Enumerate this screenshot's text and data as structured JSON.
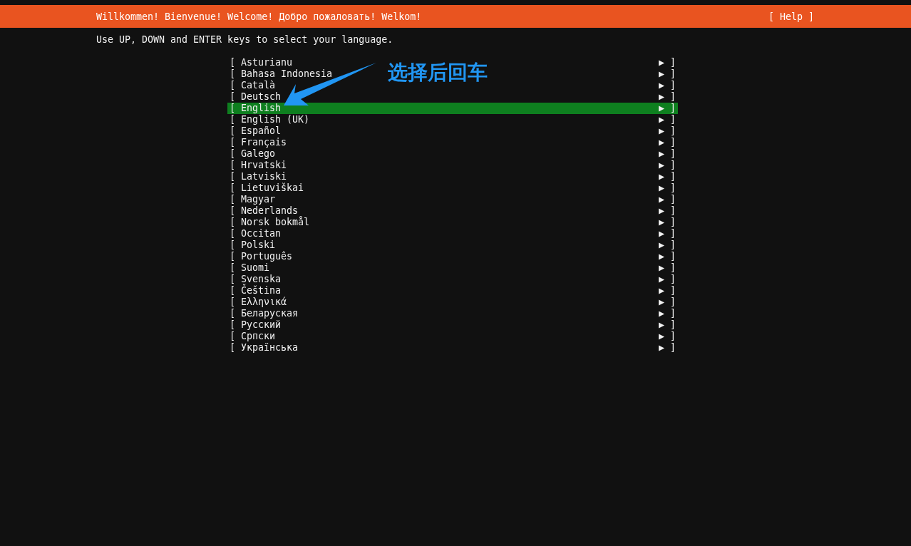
{
  "header": {
    "title": "Willkommen! Bienvenue! Welcome! Добро пожаловать! Welkom!",
    "help": "[ Help ]"
  },
  "instruction": "Use UP, DOWN and ENTER keys to select your language.",
  "languages": [
    {
      "text": "[ Asturianu",
      "end": "▶ ]",
      "selected": false
    },
    {
      "text": "[ Bahasa Indonesia",
      "end": "▶ ]",
      "selected": false
    },
    {
      "text": "[ Català",
      "end": "▶ ]",
      "selected": false
    },
    {
      "text": "[ Deutsch",
      "end": "▶ ]",
      "selected": false
    },
    {
      "text": "[ English",
      "end": "▶ ]",
      "selected": true
    },
    {
      "text": "[ English (UK)",
      "end": "▶ ]",
      "selected": false
    },
    {
      "text": "[ Español",
      "end": "▶ ]",
      "selected": false
    },
    {
      "text": "[ Français",
      "end": "▶ ]",
      "selected": false
    },
    {
      "text": "[ Galego",
      "end": "▶ ]",
      "selected": false
    },
    {
      "text": "[ Hrvatski",
      "end": "▶ ]",
      "selected": false
    },
    {
      "text": "[ Latviski",
      "end": "▶ ]",
      "selected": false
    },
    {
      "text": "[ Lietuviškai",
      "end": "▶ ]",
      "selected": false
    },
    {
      "text": "[ Magyar",
      "end": "▶ ]",
      "selected": false
    },
    {
      "text": "[ Nederlands",
      "end": "▶ ]",
      "selected": false
    },
    {
      "text": "[ Norsk bokmål",
      "end": "▶ ]",
      "selected": false
    },
    {
      "text": "[ Occitan",
      "end": "▶ ]",
      "selected": false
    },
    {
      "text": "[ Polski",
      "end": "▶ ]",
      "selected": false
    },
    {
      "text": "[ Português",
      "end": "▶ ]",
      "selected": false
    },
    {
      "text": "[ Suomi",
      "end": "▶ ]",
      "selected": false
    },
    {
      "text": "[ Svenska",
      "end": "▶ ]",
      "selected": false
    },
    {
      "text": "[ Čeština",
      "end": "▶ ]",
      "selected": false
    },
    {
      "text": "[ Ελληνικά",
      "end": "▶ ]",
      "selected": false
    },
    {
      "text": "[ Беларуская",
      "end": "▶ ]",
      "selected": false
    },
    {
      "text": "[ Русский",
      "end": "▶ ]",
      "selected": false
    },
    {
      "text": "[ Српски",
      "end": "▶ ]",
      "selected": false
    },
    {
      "text": "[ Українська",
      "end": "▶ ]",
      "selected": false
    }
  ],
  "annotation": {
    "text": "选择后回车"
  }
}
